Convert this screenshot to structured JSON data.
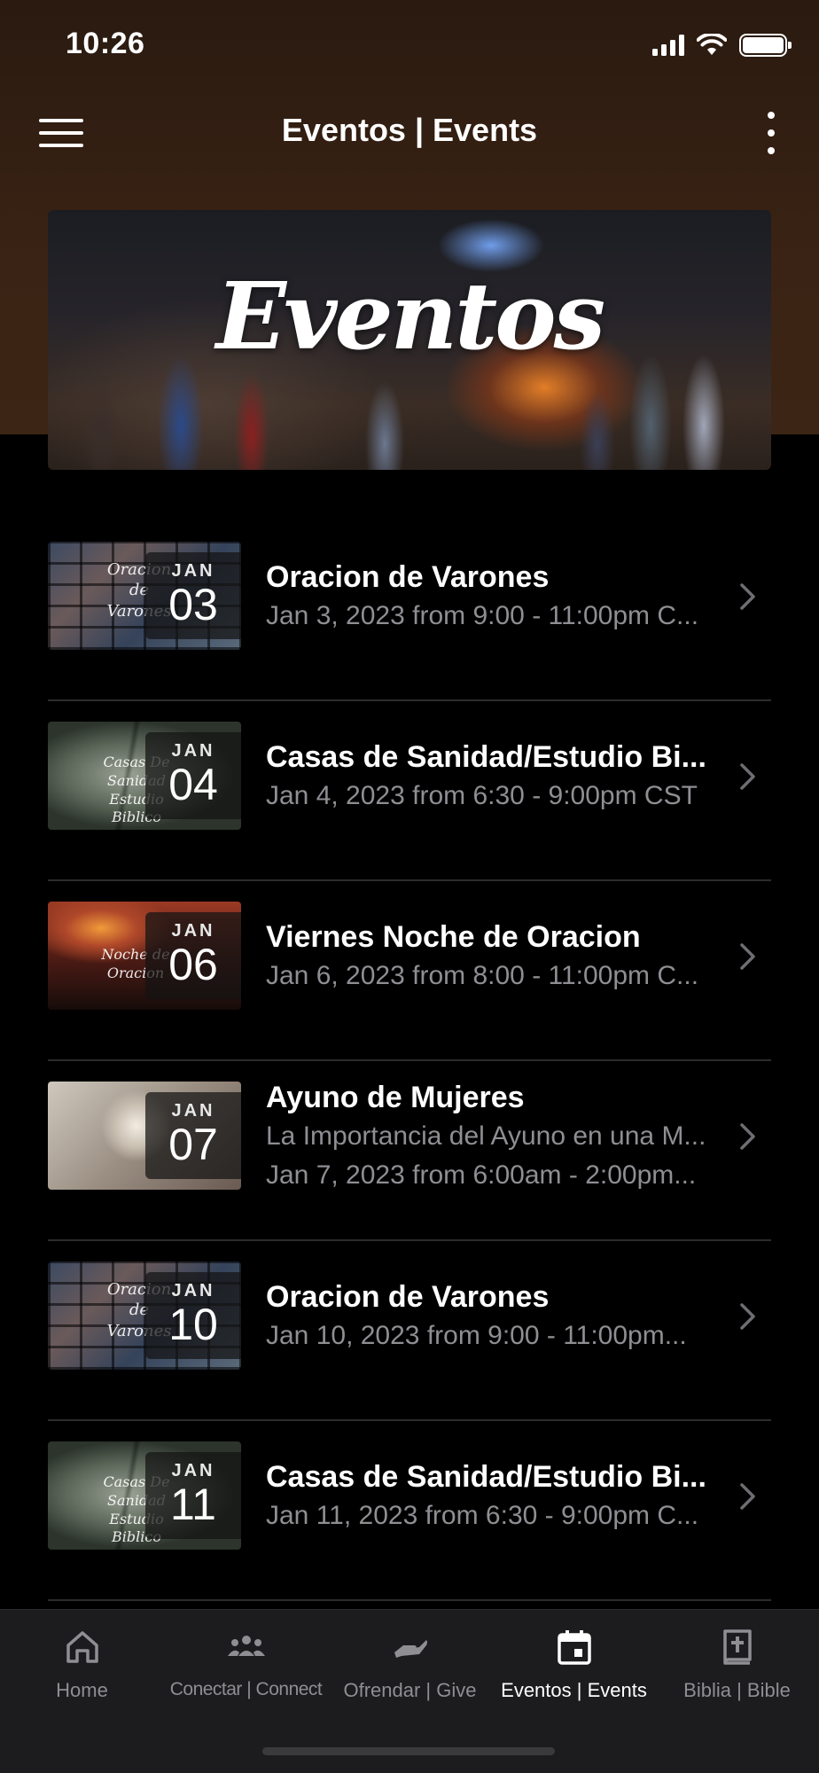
{
  "status_bar": {
    "time": "10:26"
  },
  "nav": {
    "title": "Eventos | Events"
  },
  "banner": {
    "text": "Eventos"
  },
  "events": [
    {
      "thumb_text": "Oracion de Varones",
      "month": "JAN",
      "day": "03",
      "title": "Oracion de Varones",
      "lines": [
        "Jan 3, 2023 from 9:00 - 11:00pm C..."
      ]
    },
    {
      "thumb_text": "Casas De Sanidad Estudio Biblico",
      "month": "JAN",
      "day": "04",
      "title": "Casas de Sanidad/Estudio Bi...",
      "lines": [
        "Jan 4, 2023 from 6:30 - 9:00pm CST"
      ]
    },
    {
      "thumb_text": "Noche de Oracion",
      "month": "JAN",
      "day": "06",
      "title": "Viernes Noche de Oracion",
      "lines": [
        "Jan 6, 2023 from 8:00 - 11:00pm C..."
      ]
    },
    {
      "thumb_text": "",
      "month": "JAN",
      "day": "07",
      "title": "Ayuno de Mujeres",
      "lines": [
        "La Importancia del Ayuno en una M...",
        "Jan 7, 2023 from 6:00am - 2:00pm..."
      ]
    },
    {
      "thumb_text": "Oracion de Varones",
      "month": "JAN",
      "day": "10",
      "title": "Oracion de Varones",
      "lines": [
        "Jan 10, 2023 from 9:00 - 11:00pm..."
      ]
    },
    {
      "thumb_text": "Casas De Sanidad Estudio Biblico",
      "month": "JAN",
      "day": "11",
      "title": "Casas de Sanidad/Estudio Bi...",
      "lines": [
        "Jan 11, 2023 from 6:30 - 9:00pm C..."
      ]
    }
  ],
  "tabs": [
    {
      "label": "Home",
      "icon": "home-icon",
      "active": false
    },
    {
      "label": "Conectar | Connect",
      "icon": "people-icon",
      "active": false
    },
    {
      "label": "Ofrendar | Give",
      "icon": "give-icon",
      "active": false
    },
    {
      "label": "Eventos | Events",
      "icon": "calendar-icon",
      "active": true
    },
    {
      "label": "Biblia | Bible",
      "icon": "bible-icon",
      "active": false
    }
  ],
  "colors": {
    "top_band": "#3d2515",
    "background": "#000000",
    "tab_bar": "#1c1c1e",
    "inactive": "#8e8e93",
    "active": "#ffffff"
  }
}
